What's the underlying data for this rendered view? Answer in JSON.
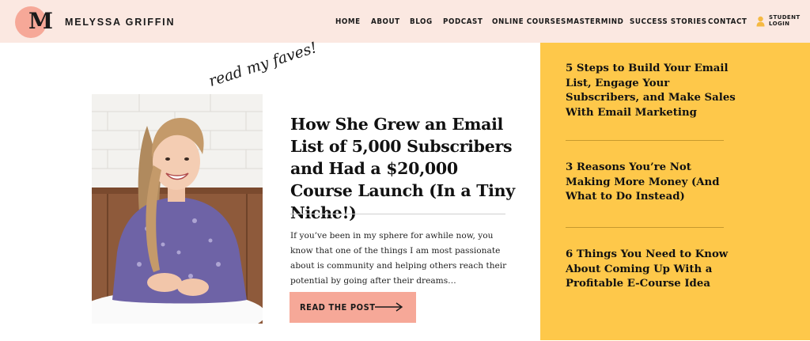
{
  "header": {
    "logo_letter": "M",
    "brand_name": "MELYSSA GRIFFIN",
    "nav": [
      "HOME",
      "ABOUT",
      "BLOG",
      "PODCAST",
      "ONLINE COURSES",
      "MASTERMIND",
      "SUCCESS STORIES",
      "CONTACT"
    ],
    "login": {
      "line1": "STUDENT",
      "line2": "LOGIN",
      "icon": "user-icon"
    }
  },
  "featured": {
    "script_label": "read my faves!",
    "title": "How She Grew an Email List of 5,000 Subscribers and Had a $20,000 Course Launch (In a Tiny Niche!)",
    "excerpt": "If you’ve been in my sphere for awhile now, you know that one of the things I am most passionate about is community and helping others reach their potential by going after their dreams…",
    "button_label": "READ THE POST",
    "button_icon": "long-arrow-right-icon"
  },
  "sidebar": {
    "posts": [
      "5 Steps to Build Your Email List, Engage Your Subscribers, and Make Sales With Email Marketing",
      "3 Reasons You’re Not Making More Money (And What to Do Instead)",
      "6 Things You Need to Know About Coming Up With a Profitable E-Course Idea"
    ]
  },
  "colors": {
    "header_bg": "#fbe8e1",
    "accent_pink": "#f6a898",
    "sidebar_yellow": "#fec84a",
    "text_dark": "#1a1a1a"
  }
}
